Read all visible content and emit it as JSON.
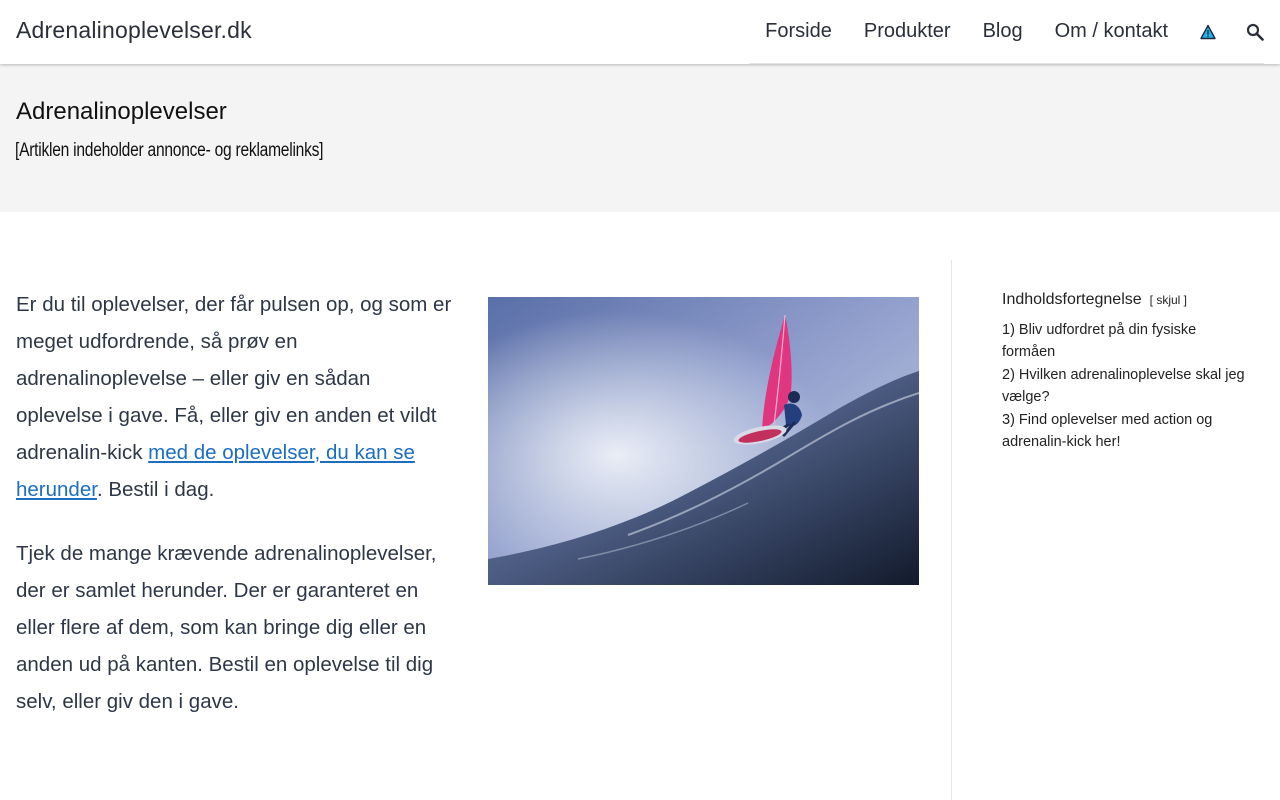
{
  "header": {
    "site_title": "Adrenalinoplevelser.dk",
    "nav": [
      "Forside",
      "Produkter",
      "Blog",
      "Om / kontakt"
    ],
    "icons": [
      "warning-triangle-icon",
      "search-icon"
    ]
  },
  "band": {
    "title": "Adrenalinoplevelser",
    "disclaimer": "[Artiklen indeholder annonce- og reklamelinks]"
  },
  "main": {
    "p1_text": "Er du til oplevelser, der får pulsen op, og som er meget udfordrende, så prøv en adrenalinoplevelse – eller giv en sådan oplevelse i gave. Få, eller giv en anden et vildt adrenalin-kick ",
    "p1_link": "med de oplevelser, du kan se herunder",
    "p1_end": ". Bestil i dag.",
    "p2": "Tjek de mange krævende adrenalinoplevelser, der er samlet herunder. Der er garanteret en eller flere af dem, som kan bringe dig eller en anden ud på kanten. Bestil en oplevelse til dig selv, eller giv den i gave."
  },
  "toc": {
    "heading": "Indholdsfortegnelse",
    "toggle": "[ skjul ]",
    "items": [
      "1) Bliv udfordret på din fysiske formåen",
      "2) Hvilken adrenalinoplevelse skal jeg vælge?",
      "3) Find oplevelser med action og adrenalin-kick her!"
    ]
  },
  "colors": {
    "link": "#1c6ec2",
    "band_bg": "#f4f4f4",
    "sail_accent": "#e0357f"
  }
}
